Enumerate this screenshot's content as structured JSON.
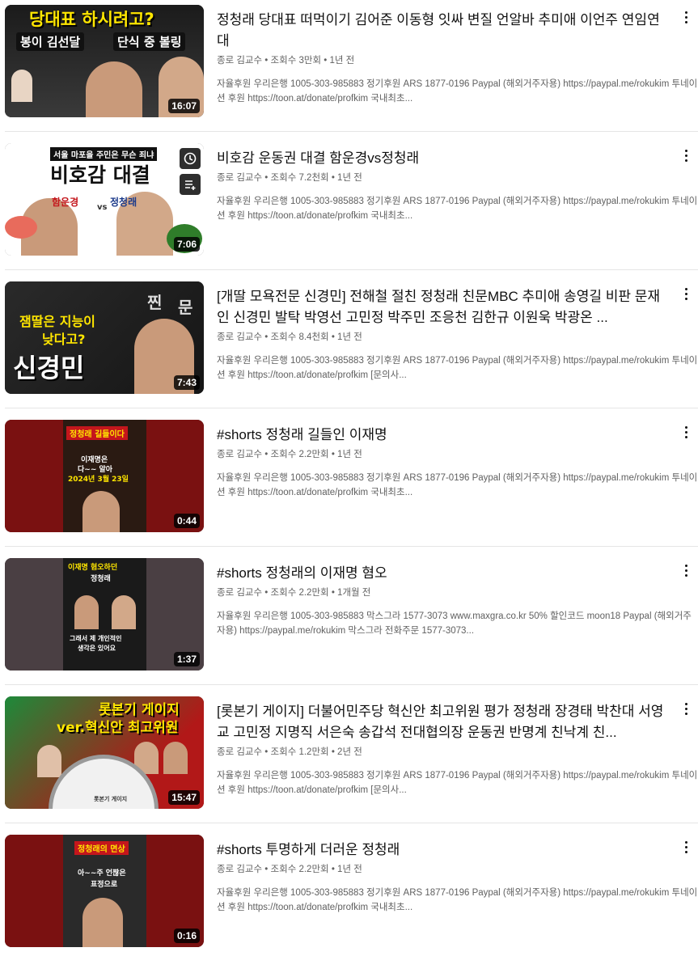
{
  "videos": [
    {
      "title": "정청래 당대표 떠먹이기 김어준 이동형 잇싸 변질 언알바 추미애 이언주 연임연대",
      "channel": "종로 김교수",
      "views": "조회수 3만회",
      "age": "1년 전",
      "desc": "자율후원 우리은행 1005-303-985883 정기후원 ARS 1877-0196 Paypal (해외거주자용) https://paypal.me/rokukim 투네이션 후원 https://toon.at/donate/profkim 국내최초...",
      "duration": "16:07",
      "thumb_text": [
        "당대표 하시려고?",
        "봉이 김선달",
        "단식 중 볼링"
      ]
    },
    {
      "title": "비호감 운동권 대결 함운경vs정청래",
      "channel": "종로 김교수",
      "views": "조회수 7.2천회",
      "age": "1년 전",
      "desc": "자율후원 우리은행 1005-303-985883 정기후원 ARS 1877-0196 Paypal (해외거주자용) https://paypal.me/rokukim 투네이션 후원 https://toon.at/donate/profkim 국내최초...",
      "duration": "7:06",
      "thumb_text": [
        "서울 마포을 주민은 무슨 죄냐",
        "비호감 대결",
        "함운경",
        "정청래",
        "vs"
      ]
    },
    {
      "title": "[개딸 모욕전문 신경민] 전해철 절친 정청래 친문MBC 추미애 송영길 비판 문재인 신경민 발탁 박영선 고민정 박주민 조응천 김한규 이원욱 박광온 ...",
      "channel": "종로 김교수",
      "views": "조회수 8.4천회",
      "age": "1년 전",
      "desc": "자율후원 우리은행 1005-303-985883 정기후원 ARS 1877-0196 Paypal (해외거주자용) https://paypal.me/rokukim 투네이션 후원 https://toon.at/donate/profkim [문의사...",
      "duration": "7:43",
      "thumb_text": [
        "잼딸은 지능이",
        "낮다고?",
        "신경민",
        "찐",
        "문"
      ]
    },
    {
      "title": "#shorts 정청래 길들인 이재명",
      "channel": "종로 김교수",
      "views": "조회수 2.2만회",
      "age": "1년 전",
      "desc": "자율후원 우리은행 1005-303-985883 정기후원 ARS 1877-0196 Paypal (해외거주자용) https://paypal.me/rokukim 투네이션 후원 https://toon.at/donate/profkim 국내최초...",
      "duration": "0:44",
      "thumb_text": [
        "정청래 길들이다",
        "이재명은",
        "다~~ 알아",
        "2024년 3월 23일"
      ]
    },
    {
      "title": "#shorts 정청래의 이재명 혐오",
      "channel": "종로 김교수",
      "views": "조회수 2.2만회",
      "age": "1개월 전",
      "desc": "자율후원 우리은행 1005-303-985883 막스그라 1577-3073 www.maxgra.co.kr 50% 할인코드 moon18 Paypal (해외거주자용) https://paypal.me/rokukim 막스그라 전화주문 1577-3073...",
      "duration": "1:37",
      "thumb_text": [
        "이재명 혐오하던",
        "정청래",
        "그래서 제 개인적인",
        "생각은 있어요"
      ]
    },
    {
      "title": "[롯본기 게이지] 더불어민주당 혁신안 최고위원 평가 정청래 장경태 박찬대 서영교 고민정 지명직 서은숙 송갑석 전대협의장 운동권 반명계 친낙계 친...",
      "channel": "종로 김교수",
      "views": "조회수 1.2만회",
      "age": "2년 전",
      "desc": "자율후원 우리은행 1005-303-985883 정기후원 ARS 1877-0196 Paypal (해외거주자용) https://paypal.me/rokukim 투네이션 후원 https://toon.at/donate/profkim [문의사...",
      "duration": "15:47",
      "thumb_text": [
        "롯본기 게이지",
        "ver.혁신안 최고위원",
        "롯본기 게이지"
      ]
    },
    {
      "title": "#shorts 투명하게 더러운 정청래",
      "channel": "종로 김교수",
      "views": "조회수 2.2만회",
      "age": "1년 전",
      "desc": "자율후원 우리은행 1005-303-985883 정기후원 ARS 1877-0196 Paypal (해외거주자용) https://paypal.me/rokukim 투네이션 후원 https://toon.at/donate/profkim 국내최초...",
      "duration": "0:16",
      "thumb_text": [
        "정청래의 면상",
        "아~~주 언짢은",
        "표정으로"
      ]
    }
  ],
  "icons": {
    "more": "more-vert-icon",
    "watch_later": "clock-icon",
    "queue": "playlist-add-icon"
  },
  "colors": {
    "accent_red": "#c4161c",
    "meta_gray": "#606060",
    "text": "#0f0f0f",
    "duration_bg": "#000000"
  }
}
